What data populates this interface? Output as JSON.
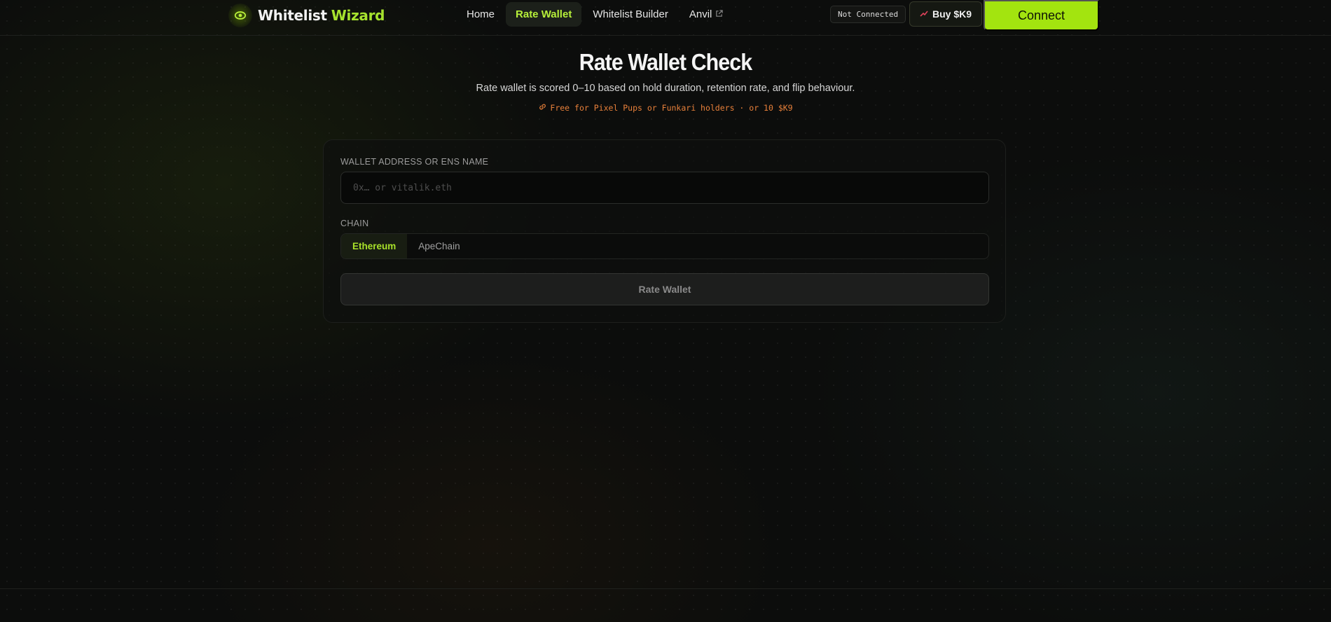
{
  "brand": {
    "name": "Whitelist",
    "accent": "Wizard",
    "accent_color": "#a3e40f",
    "logo_icon": "eye-icon"
  },
  "nav": {
    "items": [
      {
        "label": "Home",
        "active": false
      },
      {
        "label": "Rate Wallet",
        "active": true
      },
      {
        "label": "Whitelist Builder",
        "active": false
      },
      {
        "label": "Anvil",
        "active": false,
        "external": true
      }
    ],
    "external_icon": "external-link-icon"
  },
  "header": {
    "status": "Not Connected",
    "buy_label": "Buy $K9",
    "buy_icon": "chart-up-icon",
    "connect_label": "Connect"
  },
  "page": {
    "title": "Rate Wallet Check",
    "subtitle": "Rate wallet is scored 0–10 based on hold duration, retention rate, and flip behaviour.",
    "promo": "Free for Pixel Pups or Funkari holders · or 10 $K9",
    "promo_icon": "link-icon",
    "promo_color": "#e8803a"
  },
  "form": {
    "wallet_label": "WALLET ADDRESS OR ENS NAME",
    "wallet_placeholder": "0x… or vitalik.eth",
    "wallet_value": "",
    "chain_label": "CHAIN",
    "chains": [
      {
        "label": "Ethereum",
        "selected": true
      },
      {
        "label": "ApeChain",
        "selected": false
      }
    ],
    "submit_label": "Rate Wallet"
  }
}
